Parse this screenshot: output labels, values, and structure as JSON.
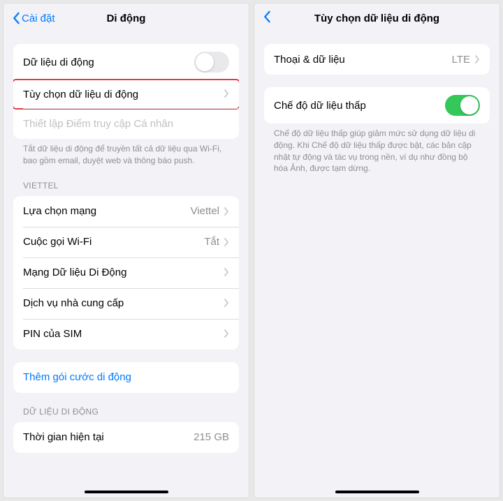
{
  "left": {
    "back_label": "Cài đặt",
    "title": "Di động",
    "rows": {
      "cellular_data": "Dữ liệu di động",
      "cellular_options": "Tùy chọn dữ liệu di động",
      "personal_hotspot": "Thiết lập Điểm truy cập Cá nhân"
    },
    "footer1": "Tắt dữ liệu di động để truyền tất cả dữ liệu qua Wi-Fi, bao gồm email, duyệt web và thông báo push.",
    "section_viettel": "VIETTEL",
    "viettel": {
      "network_selection": "Lựa chọn mạng",
      "network_selection_value": "Viettel",
      "wifi_calling": "Cuộc gọi Wi-Fi",
      "wifi_calling_value": "Tắt",
      "cellular_network": "Mạng Dữ liệu Di Động",
      "carrier_services": "Dịch vụ nhà cung cấp",
      "sim_pin": "PIN của SIM"
    },
    "add_plan": "Thêm gói cước di động",
    "section_data": "DỮ LIỆU DI ĐỘNG",
    "current_period": "Thời gian hiện tại",
    "current_period_value": "215 GB"
  },
  "right": {
    "title": "Tùy chọn dữ liệu di động",
    "voice_data": "Thoại & dữ liệu",
    "voice_data_value": "LTE",
    "low_data": "Chế độ dữ liệu thấp",
    "footer": "Chế độ dữ liệu thấp giúp giảm mức sử dụng dữ liệu di động. Khi Chế độ dữ liệu thấp được bật, các bản cập nhật tự động và tác vụ trong nền, ví dụ như đồng bộ hóa Ảnh, được tạm dừng."
  }
}
